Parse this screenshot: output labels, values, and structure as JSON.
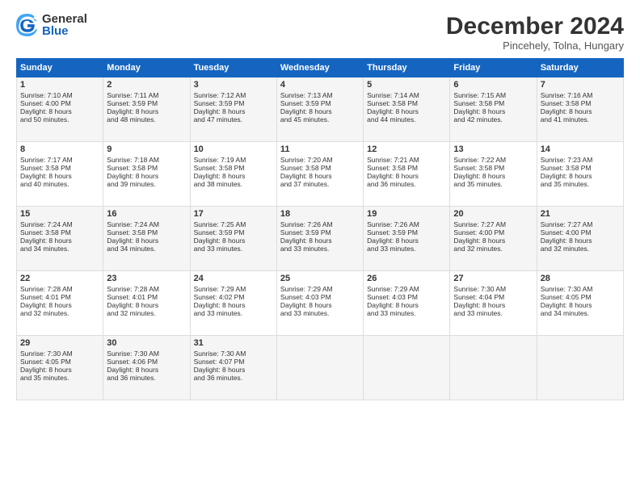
{
  "header": {
    "logo_general": "General",
    "logo_blue": "Blue",
    "month_title": "December 2024",
    "location": "Pincehely, Tolna, Hungary"
  },
  "weekdays": [
    "Sunday",
    "Monday",
    "Tuesday",
    "Wednesday",
    "Thursday",
    "Friday",
    "Saturday"
  ],
  "weeks": [
    [
      {
        "day": "1",
        "lines": [
          "Sunrise: 7:10 AM",
          "Sunset: 4:00 PM",
          "Daylight: 8 hours",
          "and 50 minutes."
        ]
      },
      {
        "day": "2",
        "lines": [
          "Sunrise: 7:11 AM",
          "Sunset: 3:59 PM",
          "Daylight: 8 hours",
          "and 48 minutes."
        ]
      },
      {
        "day": "3",
        "lines": [
          "Sunrise: 7:12 AM",
          "Sunset: 3:59 PM",
          "Daylight: 8 hours",
          "and 47 minutes."
        ]
      },
      {
        "day": "4",
        "lines": [
          "Sunrise: 7:13 AM",
          "Sunset: 3:59 PM",
          "Daylight: 8 hours",
          "and 45 minutes."
        ]
      },
      {
        "day": "5",
        "lines": [
          "Sunrise: 7:14 AM",
          "Sunset: 3:58 PM",
          "Daylight: 8 hours",
          "and 44 minutes."
        ]
      },
      {
        "day": "6",
        "lines": [
          "Sunrise: 7:15 AM",
          "Sunset: 3:58 PM",
          "Daylight: 8 hours",
          "and 42 minutes."
        ]
      },
      {
        "day": "7",
        "lines": [
          "Sunrise: 7:16 AM",
          "Sunset: 3:58 PM",
          "Daylight: 8 hours",
          "and 41 minutes."
        ]
      }
    ],
    [
      {
        "day": "8",
        "lines": [
          "Sunrise: 7:17 AM",
          "Sunset: 3:58 PM",
          "Daylight: 8 hours",
          "and 40 minutes."
        ]
      },
      {
        "day": "9",
        "lines": [
          "Sunrise: 7:18 AM",
          "Sunset: 3:58 PM",
          "Daylight: 8 hours",
          "and 39 minutes."
        ]
      },
      {
        "day": "10",
        "lines": [
          "Sunrise: 7:19 AM",
          "Sunset: 3:58 PM",
          "Daylight: 8 hours",
          "and 38 minutes."
        ]
      },
      {
        "day": "11",
        "lines": [
          "Sunrise: 7:20 AM",
          "Sunset: 3:58 PM",
          "Daylight: 8 hours",
          "and 37 minutes."
        ]
      },
      {
        "day": "12",
        "lines": [
          "Sunrise: 7:21 AM",
          "Sunset: 3:58 PM",
          "Daylight: 8 hours",
          "and 36 minutes."
        ]
      },
      {
        "day": "13",
        "lines": [
          "Sunrise: 7:22 AM",
          "Sunset: 3:58 PM",
          "Daylight: 8 hours",
          "and 35 minutes."
        ]
      },
      {
        "day": "14",
        "lines": [
          "Sunrise: 7:23 AM",
          "Sunset: 3:58 PM",
          "Daylight: 8 hours",
          "and 35 minutes."
        ]
      }
    ],
    [
      {
        "day": "15",
        "lines": [
          "Sunrise: 7:24 AM",
          "Sunset: 3:58 PM",
          "Daylight: 8 hours",
          "and 34 minutes."
        ]
      },
      {
        "day": "16",
        "lines": [
          "Sunrise: 7:24 AM",
          "Sunset: 3:58 PM",
          "Daylight: 8 hours",
          "and 34 minutes."
        ]
      },
      {
        "day": "17",
        "lines": [
          "Sunrise: 7:25 AM",
          "Sunset: 3:59 PM",
          "Daylight: 8 hours",
          "and 33 minutes."
        ]
      },
      {
        "day": "18",
        "lines": [
          "Sunrise: 7:26 AM",
          "Sunset: 3:59 PM",
          "Daylight: 8 hours",
          "and 33 minutes."
        ]
      },
      {
        "day": "19",
        "lines": [
          "Sunrise: 7:26 AM",
          "Sunset: 3:59 PM",
          "Daylight: 8 hours",
          "and 33 minutes."
        ]
      },
      {
        "day": "20",
        "lines": [
          "Sunrise: 7:27 AM",
          "Sunset: 4:00 PM",
          "Daylight: 8 hours",
          "and 32 minutes."
        ]
      },
      {
        "day": "21",
        "lines": [
          "Sunrise: 7:27 AM",
          "Sunset: 4:00 PM",
          "Daylight: 8 hours",
          "and 32 minutes."
        ]
      }
    ],
    [
      {
        "day": "22",
        "lines": [
          "Sunrise: 7:28 AM",
          "Sunset: 4:01 PM",
          "Daylight: 8 hours",
          "and 32 minutes."
        ]
      },
      {
        "day": "23",
        "lines": [
          "Sunrise: 7:28 AM",
          "Sunset: 4:01 PM",
          "Daylight: 8 hours",
          "and 32 minutes."
        ]
      },
      {
        "day": "24",
        "lines": [
          "Sunrise: 7:29 AM",
          "Sunset: 4:02 PM",
          "Daylight: 8 hours",
          "and 33 minutes."
        ]
      },
      {
        "day": "25",
        "lines": [
          "Sunrise: 7:29 AM",
          "Sunset: 4:03 PM",
          "Daylight: 8 hours",
          "and 33 minutes."
        ]
      },
      {
        "day": "26",
        "lines": [
          "Sunrise: 7:29 AM",
          "Sunset: 4:03 PM",
          "Daylight: 8 hours",
          "and 33 minutes."
        ]
      },
      {
        "day": "27",
        "lines": [
          "Sunrise: 7:30 AM",
          "Sunset: 4:04 PM",
          "Daylight: 8 hours",
          "and 33 minutes."
        ]
      },
      {
        "day": "28",
        "lines": [
          "Sunrise: 7:30 AM",
          "Sunset: 4:05 PM",
          "Daylight: 8 hours",
          "and 34 minutes."
        ]
      }
    ],
    [
      {
        "day": "29",
        "lines": [
          "Sunrise: 7:30 AM",
          "Sunset: 4:05 PM",
          "Daylight: 8 hours",
          "and 35 minutes."
        ]
      },
      {
        "day": "30",
        "lines": [
          "Sunrise: 7:30 AM",
          "Sunset: 4:06 PM",
          "Daylight: 8 hours",
          "and 36 minutes."
        ]
      },
      {
        "day": "31",
        "lines": [
          "Sunrise: 7:30 AM",
          "Sunset: 4:07 PM",
          "Daylight: 8 hours",
          "and 36 minutes."
        ]
      },
      null,
      null,
      null,
      null
    ]
  ]
}
